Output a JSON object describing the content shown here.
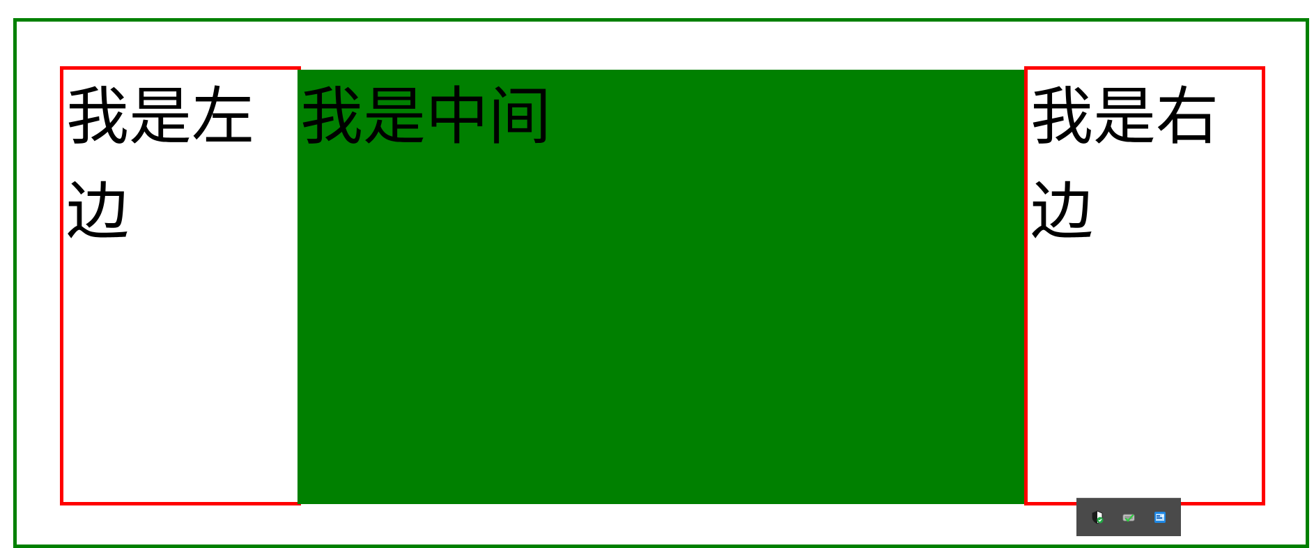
{
  "layout": {
    "left": {
      "text": "我是左边"
    },
    "middle": {
      "text": "我是中间"
    },
    "right": {
      "text": "我是右边"
    }
  },
  "colors": {
    "outer_border": "#008000",
    "side_border": "#ff0000",
    "middle_bg": "#008000",
    "tray_bg": "#4a4a4a"
  },
  "tray": {
    "icons": [
      "shield-check-icon",
      "network-check-icon",
      "app-window-icon"
    ]
  }
}
